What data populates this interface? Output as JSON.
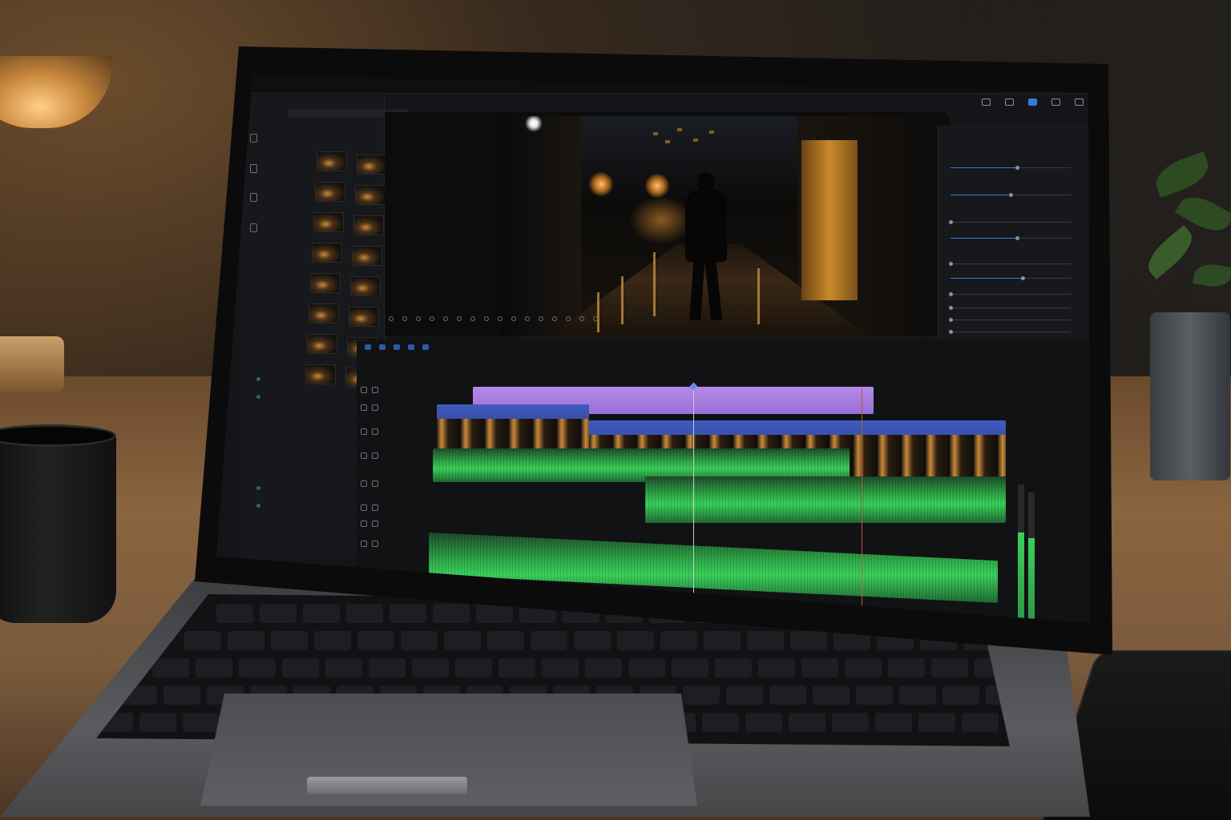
{
  "app": {
    "menu": [
      "",
      "",
      "",
      "",
      ""
    ],
    "title": "",
    "top_icons": [
      "monitor-icon",
      "square-icon",
      "active-panel-icon",
      "expand-icon",
      "share-icon"
    ]
  },
  "media_panel": {
    "path": "",
    "nav_items": [
      {
        "icon": "folder-icon",
        "label": ""
      },
      {
        "icon": "clip-icon",
        "label": ""
      },
      {
        "icon": "audio-icon",
        "label": ""
      },
      {
        "icon": "effects-icon",
        "label": ""
      }
    ],
    "section_label": "",
    "section_items": [
      ""
    ],
    "lower_section_label": "",
    "lower_items": [
      "",
      ""
    ],
    "bottom_section_label": "",
    "bottom_items": [
      "",
      ""
    ]
  },
  "viewer": {
    "label": "",
    "header_text": ""
  },
  "inspector": {
    "title": "",
    "rows": [
      {
        "label": "",
        "level": 0.55
      },
      {
        "label": "",
        "level": 0.5
      },
      {
        "label": "",
        "level": 0.0
      },
      {
        "label": "",
        "level": 0.55
      },
      {
        "label": "",
        "level": 0.0
      },
      {
        "label": "",
        "level": 0.6
      },
      {
        "label": "",
        "level": 0.0
      },
      {
        "label": "",
        "level": 0.0
      },
      {
        "label": "",
        "level": 0.0
      },
      {
        "label": "",
        "level": 0.0
      },
      {
        "label": "",
        "level": 0.0
      }
    ]
  },
  "timeline": {
    "track_count": 8,
    "colors": {
      "title_clip": "#b48ae8",
      "video_clip": "#3f5bbf",
      "audio_clip": "#3ad05a",
      "accent": "#2f7ae0"
    }
  }
}
